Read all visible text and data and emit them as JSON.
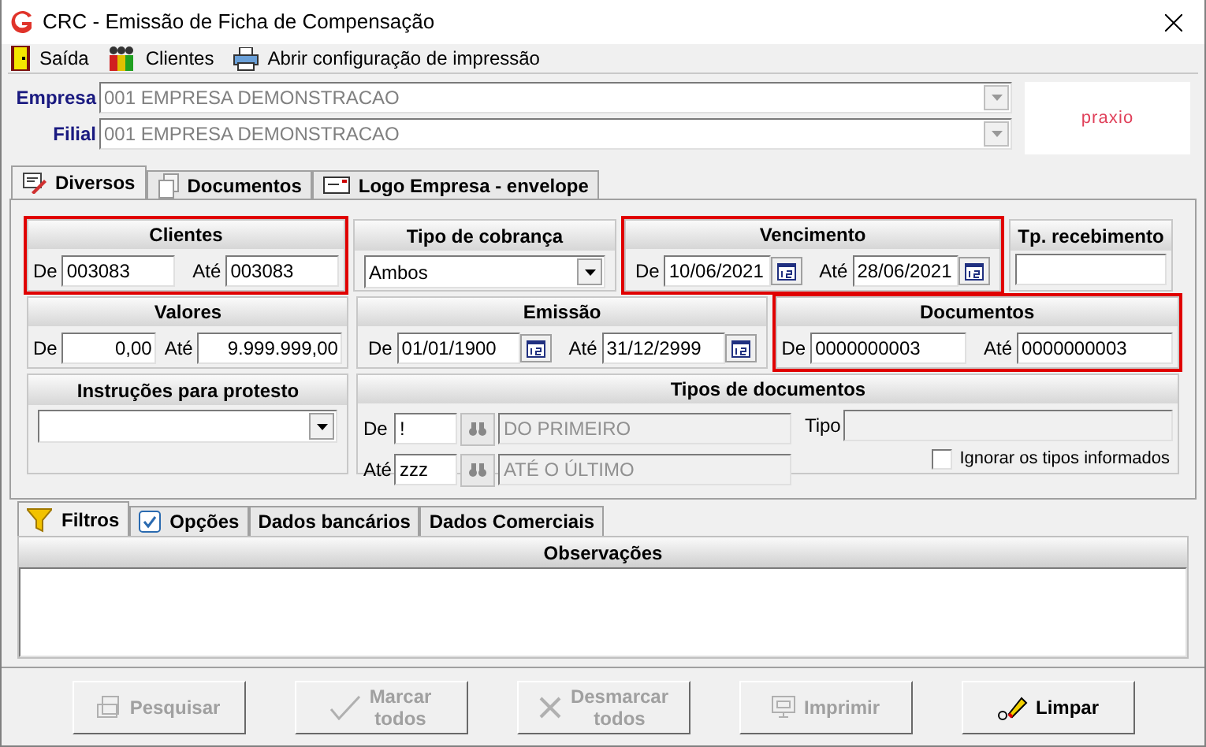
{
  "window": {
    "title": "CRC - Emissão de Ficha de Compensação"
  },
  "toolbar": [
    {
      "label": "Saída",
      "kind": "exit"
    },
    {
      "label": "Clientes",
      "kind": "clients"
    },
    {
      "label": "Abrir configuração de impressão",
      "kind": "print"
    }
  ],
  "header": {
    "fields": [
      {
        "label": "Empresa",
        "value": "001 EMPRESA DEMONSTRACAO"
      },
      {
        "label": "Filial",
        "value": "001 EMPRESA DEMONSTRACAO"
      }
    ],
    "logo": "praxio"
  },
  "tabs": [
    {
      "label": "Diversos",
      "kind": "notes",
      "selected": true
    },
    {
      "label": "Documentos",
      "kind": "pages",
      "selected": false
    },
    {
      "label": "Logo Empresa - envelope",
      "kind": "envelope",
      "selected": false
    }
  ],
  "filter_rows": [
    [
      {
        "title": "Clientes",
        "kind": "range",
        "highlighted": true,
        "fields": [
          {
            "label": "De",
            "value": "003083"
          },
          {
            "label": "Até",
            "value": "003083"
          }
        ]
      },
      {
        "title": "Tipo de cobrança",
        "kind": "select",
        "highlighted": false,
        "value": "Ambos"
      },
      {
        "title": "Vencimento",
        "kind": "date_range",
        "highlighted": true,
        "fields": [
          {
            "label": "De",
            "value": "10/06/2021"
          },
          {
            "label": "Até",
            "value": "28/06/2021"
          }
        ]
      },
      {
        "title": "Tp. recebimento",
        "kind": "text",
        "highlighted": false
      }
    ],
    [
      {
        "title": "Valores",
        "kind": "amount_range",
        "highlighted": false,
        "fields": [
          {
            "label": "De",
            "value": "0,00"
          },
          {
            "label": "Até",
            "value": "9.999.999,00"
          }
        ]
      },
      {
        "title": "Emissão",
        "kind": "date_range",
        "highlighted": false,
        "fields": [
          {
            "label": "De",
            "value": "01/01/1900"
          },
          {
            "label": "Até",
            "value": "31/12/2999"
          }
        ]
      },
      {
        "title": "Documentos",
        "kind": "range",
        "highlighted": true,
        "fields": [
          {
            "label": "De",
            "value": "0000000003"
          },
          {
            "label": "Até",
            "value": "0000000003"
          }
        ]
      }
    ],
    [
      {
        "title": "Instruções para protesto",
        "kind": "select",
        "highlighted": false
      },
      {
        "title": "Tipos de documentos",
        "kind": "doc_types",
        "highlighted": false,
        "fields": [
          {
            "label": "De",
            "value": "!",
            "description": "DO PRIMEIRO"
          },
          {
            "label": "Até",
            "value": "zzz",
            "description": "ATÉ O ÚLTIMO"
          }
        ],
        "type_label": "Tipo",
        "checkbox": {
          "label": "Ignorar os tipos informados",
          "checked": false
        }
      }
    ]
  ],
  "bottom_tabs": [
    {
      "label": "Filtros",
      "kind": "funnel",
      "selected": true
    },
    {
      "label": "Opções",
      "kind": "check",
      "selected": false
    },
    {
      "label": "Dados bancários",
      "kind": "none",
      "selected": false
    },
    {
      "label": "Dados Comerciais",
      "kind": "none",
      "selected": false
    }
  ],
  "observations": {
    "title": "Observações"
  },
  "buttons": [
    {
      "lines": [
        "Pesquisar"
      ],
      "kind": "search",
      "disabled": true
    },
    {
      "lines": [
        "Marcar",
        "todos"
      ],
      "kind": "check",
      "disabled": true
    },
    {
      "lines": [
        "Desmarcar",
        "todos"
      ],
      "kind": "cross",
      "disabled": true
    },
    {
      "lines": [
        "Imprimir"
      ],
      "kind": "monitor",
      "disabled": true
    },
    {
      "lines": [
        "Limpar"
      ],
      "kind": "eraser",
      "disabled": false
    }
  ]
}
